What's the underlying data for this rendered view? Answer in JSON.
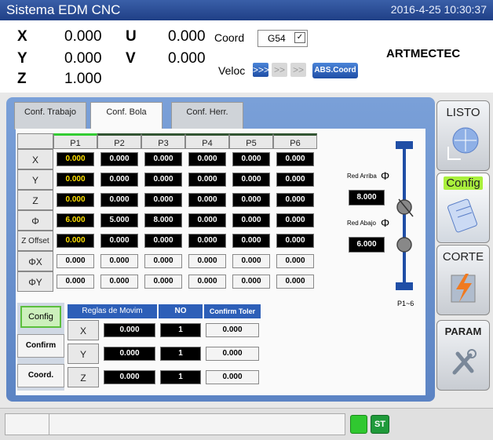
{
  "title": "Sistema EDM CNC",
  "datetime": "2016-4-25 10:30:37",
  "axes": [
    {
      "name": "X",
      "value": "0.000"
    },
    {
      "name": "Y",
      "value": "0.000"
    },
    {
      "name": "Z",
      "value": "1.000"
    },
    {
      "name": "U",
      "value": "0.000"
    },
    {
      "name": "V",
      "value": "0.000"
    }
  ],
  "coord": {
    "label": "Coord",
    "value": "G54"
  },
  "veloc": {
    "label": "Veloc",
    "levels": [
      ">>>",
      ">>",
      ">>"
    ]
  },
  "abs_coord_label": "ABS.Coord",
  "brand": "ARTMECTEC",
  "tabs": [
    "Conf. Trabajo",
    "Conf. Bola",
    "Conf. Herr."
  ],
  "grid": {
    "cols": [
      "P1",
      "P2",
      "P3",
      "P4",
      "P5",
      "P6"
    ],
    "rows": [
      {
        "label": "X",
        "values": [
          "0.000",
          "0.000",
          "0.000",
          "0.000",
          "0.000",
          "0.000"
        ]
      },
      {
        "label": "Y",
        "values": [
          "0.000",
          "0.000",
          "0.000",
          "0.000",
          "0.000",
          "0.000"
        ]
      },
      {
        "label": "Z",
        "values": [
          "0.000",
          "0.000",
          "0.000",
          "0.000",
          "0.000",
          "0.000"
        ]
      },
      {
        "label": "Φ",
        "values": [
          "6.000",
          "5.000",
          "8.000",
          "0.000",
          "0.000",
          "0.000"
        ]
      },
      {
        "label": "Z Offset",
        "values": [
          "0.000",
          "0.000",
          "0.000",
          "0.000",
          "0.000",
          "0.000"
        ]
      },
      {
        "label": "ΦX",
        "values": [
          "0.000",
          "0.000",
          "0.000",
          "0.000",
          "0.000",
          "0.000"
        ]
      },
      {
        "label": "ΦY",
        "values": [
          "0.000",
          "0.000",
          "0.000",
          "0.000",
          "0.000",
          "0.000"
        ]
      }
    ]
  },
  "red_arriba": {
    "label": "Red Arriba",
    "symbol": "Φ",
    "value": "8.000"
  },
  "red_abajo": {
    "label": "Red Abajo",
    "symbol": "Φ",
    "value": "6.000"
  },
  "p_range": "P1~6",
  "side_buttons": [
    "Config",
    "Confirm",
    "Coord."
  ],
  "reglas": {
    "headers": [
      "Reglas de Movim",
      "NO",
      "Confirm Toler"
    ],
    "rows": [
      {
        "axis": "X",
        "value": "0.000",
        "no": "1",
        "toler": "0.000"
      },
      {
        "axis": "Y",
        "value": "0.000",
        "no": "1",
        "toler": "0.000"
      },
      {
        "axis": "Z",
        "value": "0.000",
        "no": "1",
        "toler": "0.000"
      }
    ]
  },
  "right_buttons": [
    "LISTO",
    "Config",
    "CORTE",
    "PARAM"
  ],
  "status": {
    "st_label": "ST"
  }
}
